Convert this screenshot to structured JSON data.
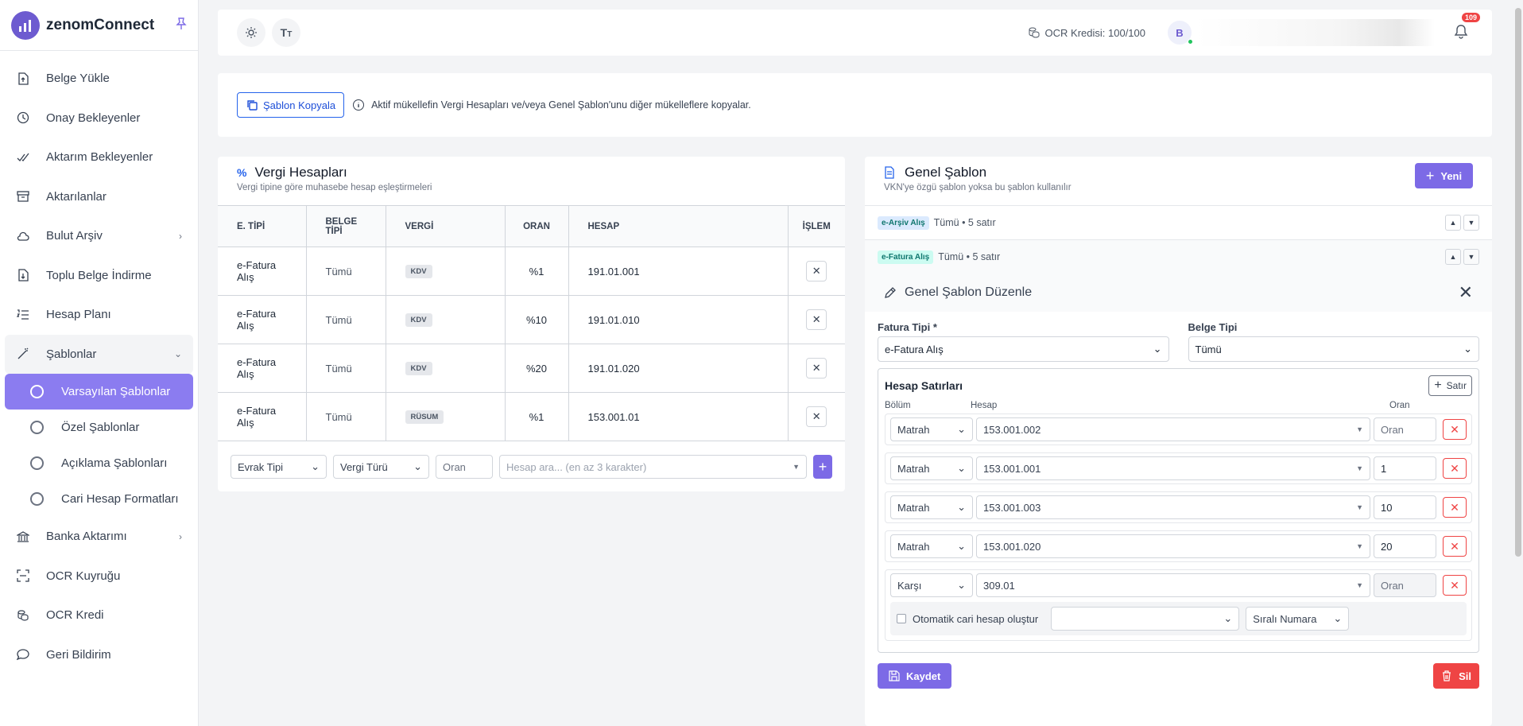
{
  "app": {
    "name": "zenomConnect"
  },
  "sidebar": {
    "items": [
      {
        "label": "Belge Yükle",
        "icon": "document-upload-icon"
      },
      {
        "label": "Onay Bekleyenler",
        "icon": "clock-icon"
      },
      {
        "label": "Aktarım Bekleyenler",
        "icon": "double-check-icon"
      },
      {
        "label": "Aktarılanlar",
        "icon": "archive-icon"
      },
      {
        "label": "Bulut Arşiv",
        "icon": "cloud-icon"
      },
      {
        "label": "Toplu Belge İndirme",
        "icon": "file-download-icon"
      },
      {
        "label": "Hesap Planı",
        "icon": "list-ordered-icon"
      },
      {
        "label": "Şablonlar",
        "icon": "magic-wand-icon"
      }
    ],
    "subitems": [
      {
        "label": "Varsayılan Şablonlar"
      },
      {
        "label": "Özel Şablonlar"
      },
      {
        "label": "Açıklama Şablonları"
      },
      {
        "label": "Cari Hesap Formatları"
      }
    ],
    "items2": [
      {
        "label": "Banka Aktarımı",
        "icon": "bank-icon"
      },
      {
        "label": "OCR Kuyruğu",
        "icon": "scan-icon"
      },
      {
        "label": "OCR Kredi",
        "icon": "coins-icon"
      },
      {
        "label": "Geri Bildirim",
        "icon": "chat-bubble-icon"
      }
    ]
  },
  "topbar": {
    "ocr_label": "OCR Kredisi: 100/100",
    "avatar_letter": "B",
    "notif_count": "109"
  },
  "copybar": {
    "button": "Şablon Kopyala",
    "note": "Aktif mükellefin Vergi Hesapları ve/veya Genel Şablon'unu diğer mükelleflere kopyalar."
  },
  "vergi": {
    "title": "Vergi Hesapları",
    "subtitle": "Vergi tipine göre muhasebe hesap eşleştirmeleri",
    "columns": [
      "E. TİPİ",
      "BELGE TİPİ",
      "VERGİ",
      "ORAN",
      "HESAP",
      "İŞLEM"
    ],
    "rows": [
      {
        "etipi": "e-Fatura Alış",
        "belge": "Tümü",
        "vergi": "KDV",
        "oran": "%1",
        "hesap": "191.01.001"
      },
      {
        "etipi": "e-Fatura Alış",
        "belge": "Tümü",
        "vergi": "KDV",
        "oran": "%10",
        "hesap": "191.01.010"
      },
      {
        "etipi": "e-Fatura Alış",
        "belge": "Tümü",
        "vergi": "KDV",
        "oran": "%20",
        "hesap": "191.01.020"
      },
      {
        "etipi": "e-Fatura Alış",
        "belge": "Tümü",
        "vergi": "RÜSUM",
        "oran": "%1",
        "hesap": "153.001.01"
      }
    ],
    "footer": {
      "evrak": "Evrak Tipi",
      "vergi_turu": "Vergi Türü",
      "oran_ph": "Oran",
      "hesap_ph": "Hesap ara... (en az 3 karakter)"
    }
  },
  "genel": {
    "title": "Genel Şablon",
    "subtitle": "VKN'ye özgü şablon yoksa bu şablon kullanılır",
    "new_button": "Yeni",
    "accordions": [
      {
        "badge": "e-Arşiv Alış",
        "text": "Tümü • 5 satır"
      },
      {
        "badge": "e-Fatura Alış",
        "text": "Tümü • 5 satır"
      }
    ],
    "edit": {
      "title": "Genel Şablon Düzenle",
      "fatura_label": "Fatura Tipi *",
      "fatura_value": "e-Fatura Alış",
      "belge_label": "Belge Tipi",
      "belge_value": "Tümü",
      "hs_title": "Hesap Satırları",
      "satir_button": "Satır",
      "col_bolum": "Bölüm",
      "col_hesap": "Hesap",
      "col_oran": "Oran",
      "rows": [
        {
          "bolum": "Matrah",
          "hesap": "153.001.002",
          "oran": "Oran"
        },
        {
          "bolum": "Matrah",
          "hesap": "153.001.001",
          "oran": "1"
        },
        {
          "bolum": "Matrah",
          "hesap": "153.001.003",
          "oran": "10"
        },
        {
          "bolum": "Matrah",
          "hesap": "153.001.020",
          "oran": "20"
        }
      ],
      "karsi": {
        "bolum": "Karşı",
        "hesap": "309.01",
        "oran": "Oran"
      },
      "oto_label": "Otomatik cari hesap oluştur",
      "sira_label": "Sıralı Numara",
      "save": "Kaydet",
      "delete": "Sil"
    }
  }
}
